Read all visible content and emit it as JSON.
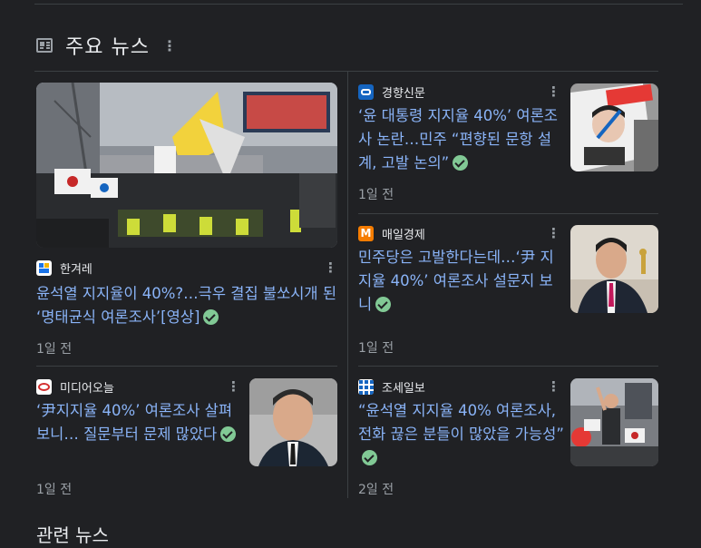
{
  "section": {
    "title": "주요 뉴스",
    "more_icon": "more-vert-icon",
    "news_icon": "newspaper-icon"
  },
  "articles": [
    {
      "source": "한겨레",
      "headline": "윤석열 지지율이 40%?…극우 결집 불쏘시개 된 ‘명태균식 여론조사’[영상]",
      "age": "1일 전",
      "verified": true,
      "logo_colors": [
        "#ffffff",
        "#1a73e8",
        "#f4b400"
      ]
    },
    {
      "source": "경향신문",
      "headline": "‘윤 대통령 지지율 40%’ 여론조사 논란…민주 “편향된 문항 설계, 고발 논의”",
      "age": "1일 전",
      "verified": true,
      "logo_colors": [
        "#1565c0"
      ]
    },
    {
      "source": "매일경제",
      "headline": "민주당은 고발한다는데…‘尹 지지율 40%’ 여론조사 설문지 보니",
      "age": "1일 전",
      "verified": true,
      "logo_colors": [
        "#f57c00"
      ]
    },
    {
      "source": "미디어오늘",
      "headline": "‘尹지지율 40%’ 여론조사 살펴보니… 질문부터 문제 많았다",
      "age": "1일 전",
      "verified": true,
      "logo_colors": [
        "#ffffff",
        "#d32f2f"
      ]
    },
    {
      "source": "조세일보",
      "headline": "“윤석열 지지율 40% 여론조사, 전화 끊은 분들이 많았을 가능성”",
      "age": "2일 전",
      "verified": true,
      "logo_colors": [
        "#1565c0",
        "#ffffff"
      ]
    }
  ],
  "related": {
    "title": "관련 뉴스"
  }
}
